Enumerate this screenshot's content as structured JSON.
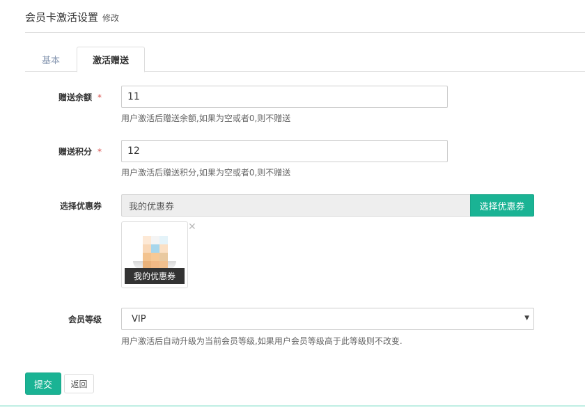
{
  "header": {
    "title": "会员卡激活设置",
    "subtitle": "修改"
  },
  "tabs": [
    {
      "label": "基本",
      "active": false
    },
    {
      "label": "激活赠送",
      "active": true
    }
  ],
  "form": {
    "balance": {
      "label": "赠送余额",
      "required_mark": "*",
      "value": "11",
      "help": "用户激活后赠送余额,如果为空或者0,则不赠送"
    },
    "points": {
      "label": "赠送积分",
      "required_mark": "*",
      "value": "12",
      "help": "用户激活后赠送积分,如果为空或者0,则不赠送"
    },
    "coupon": {
      "label": "选择优惠券",
      "selected_text": "我的优惠券",
      "button_label": "选择优惠券",
      "card_caption": "我的优惠券",
      "remove_glyph": "✕"
    },
    "level": {
      "label": "会员等级",
      "selected": "VIP",
      "help": "用户激活后自动升级为当前会员等级,如果用户会员等级高于此等级则不改变."
    }
  },
  "actions": {
    "submit_label": "提交",
    "back_label": "返回"
  },
  "colors": {
    "accent": "#1ab394",
    "required": "#d9534f",
    "inactive_tab": "#8a9ab3"
  }
}
